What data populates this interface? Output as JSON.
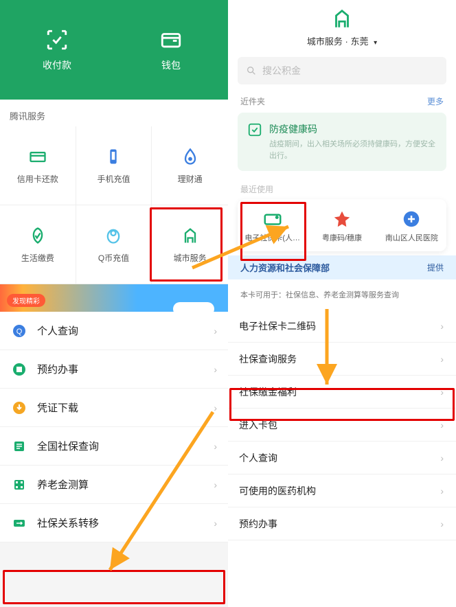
{
  "left": {
    "pay": {
      "scan_label": "收付款",
      "wallet_label": "钱包"
    },
    "section_title": "腾讯服务",
    "grid": [
      {
        "label": "信用卡还款"
      },
      {
        "label": "手机充值"
      },
      {
        "label": "理财通"
      },
      {
        "label": "生活缴费"
      },
      {
        "label": "Q币充值"
      },
      {
        "label": "城市服务"
      }
    ],
    "banner_tag": "发现精彩",
    "list": [
      {
        "label": "个人查询"
      },
      {
        "label": "预约办事"
      },
      {
        "label": "凭证下载"
      },
      {
        "label": "全国社保查询"
      },
      {
        "label": "养老金测算"
      },
      {
        "label": "社保关系转移"
      }
    ]
  },
  "right": {
    "city": "城市服务 · 东莞",
    "search_placeholder": "搜公积金",
    "sec_recent": "近件夹",
    "more": "更多",
    "health": {
      "title": "防疫健康码",
      "sub": "战疫期间，出入相关场所必须持健康码，方便安全出行。"
    },
    "sec_fav": "最近使用",
    "grid": [
      {
        "label": "电子社保卡(人…"
      },
      {
        "label": "粤康码/穗康"
      },
      {
        "label": "南山区人民医院"
      }
    ],
    "bluebar_left": "人力资源和社会保障部",
    "bluebar_right": "提供",
    "note": "本卡可用于：社保信息、养老金测算等服务查询",
    "list": [
      "电子社保卡二维码",
      "社保查询服务",
      "社保缴金福利",
      "进入卡包",
      "个人查询",
      "可使用的医药机构",
      "预约办事"
    ]
  }
}
